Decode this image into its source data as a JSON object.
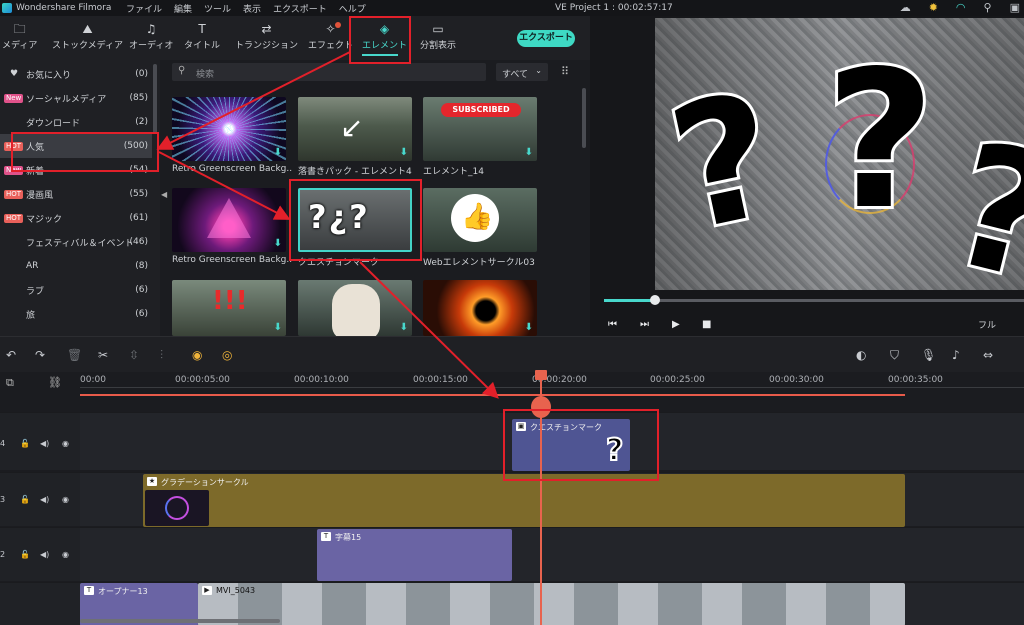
{
  "app": {
    "name": "Wondershare Filmora",
    "project_title": "VE Project 1 : 00:02:57:17",
    "menu": [
      "ファイル",
      "編集",
      "ツール",
      "表示",
      "エクスポート",
      "ヘルプ"
    ]
  },
  "toolbar": {
    "tabs": [
      {
        "label": "メディア",
        "icon": "folder-icon"
      },
      {
        "label": "ストックメディア",
        "icon": "stock-icon"
      },
      {
        "label": "オーディオ",
        "icon": "music-icon"
      },
      {
        "label": "タイトル",
        "icon": "title-icon"
      },
      {
        "label": "トランジション",
        "icon": "transition-icon"
      },
      {
        "label": "エフェクト",
        "icon": "effect-icon"
      },
      {
        "label": "エレメント",
        "icon": "element-icon",
        "active": true
      },
      {
        "label": "分割表示",
        "icon": "split-icon"
      }
    ],
    "export_label": "エクスポート"
  },
  "sidebar": {
    "items": [
      {
        "label": "お気に入り",
        "count": "(0)",
        "badge": ""
      },
      {
        "label": "ソーシャルメディア",
        "count": "(85)",
        "badge": "New"
      },
      {
        "label": "ダウンロード",
        "count": "(2)",
        "badge": ""
      },
      {
        "label": "人気",
        "count": "(500)",
        "badge": "HOT",
        "selected": true
      },
      {
        "label": "新着",
        "count": "(54)",
        "badge": "New"
      },
      {
        "label": "漫画風",
        "count": "(55)",
        "badge": "HOT"
      },
      {
        "label": "マジック",
        "count": "(61)",
        "badge": "HOT"
      },
      {
        "label": "フェスティバル＆イベント",
        "count": "(46)",
        "badge": ""
      },
      {
        "label": "AR",
        "count": "(8)",
        "badge": ""
      },
      {
        "label": "ラブ",
        "count": "(6)",
        "badge": ""
      },
      {
        "label": "旅",
        "count": "(6)",
        "badge": ""
      }
    ]
  },
  "search": {
    "placeholder": "検索",
    "filter": "すべて"
  },
  "library": {
    "items": [
      {
        "label": "Retro Greenscreen Backg..."
      },
      {
        "label": "落書きパック - エレメント4"
      },
      {
        "label": "エレメント_14",
        "banner": "SUBSCRIBED"
      },
      {
        "label": "Retro Greenscreen Backg..."
      },
      {
        "label": "クエスチョンマーク",
        "overlay": "?"
      },
      {
        "label": "Webエレメントサークル03"
      },
      {
        "label": ""
      },
      {
        "label": ""
      },
      {
        "label": ""
      }
    ]
  },
  "preview": {
    "zoom": "フル",
    "progress": 0.11
  },
  "timeline": {
    "ruler": [
      "00:00",
      "00:00:05:00",
      "00:00:10:00",
      "00:00:15:00",
      "00:00:20:00",
      "00:00:25:00",
      "00:00:30:00",
      "00:00:35:00"
    ],
    "tracks": [
      {
        "num": "4",
        "clips": [
          {
            "label": "クエスチョンマーク"
          }
        ]
      },
      {
        "num": "3",
        "clips": [
          {
            "label": "グラデーションサークル"
          }
        ]
      },
      {
        "num": "2",
        "clips": [
          {
            "label": "字幕15"
          }
        ]
      },
      {
        "num": "1",
        "clips": [
          {
            "label": "オープナー13"
          },
          {
            "label": "MVI_5043"
          }
        ]
      }
    ]
  }
}
